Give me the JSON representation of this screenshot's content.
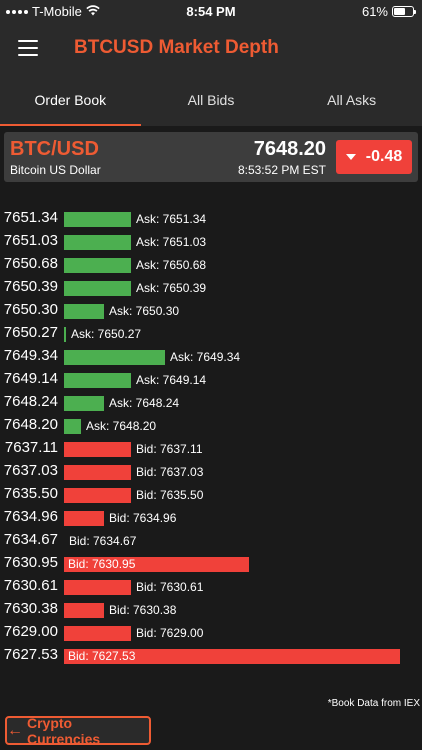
{
  "status": {
    "carrier": "T-Mobile",
    "time": "8:54 PM",
    "battery": "61%",
    "battery_level": 0.61
  },
  "header": {
    "title": "BTCUSD Market Depth"
  },
  "tabs": [
    {
      "label": "Order Book",
      "active": true
    },
    {
      "label": "All Bids",
      "active": false
    },
    {
      "label": "All Asks",
      "active": false
    }
  ],
  "ticker": {
    "symbol": "BTC/USD",
    "name": "Bitcoin US Dollar",
    "price": "7648.20",
    "time": "8:53:52 PM EST",
    "change": "-0.48"
  },
  "order_book": {
    "max_size": 1.0,
    "rows": [
      {
        "price": "7651.34",
        "side": "ask",
        "label": "Ask: 7651.34",
        "size": 0.2
      },
      {
        "price": "7651.03",
        "side": "ask",
        "label": "Ask: 7651.03",
        "size": 0.2
      },
      {
        "price": "7650.68",
        "side": "ask",
        "label": "Ask: 7650.68",
        "size": 0.2
      },
      {
        "price": "7650.39",
        "side": "ask",
        "label": "Ask: 7650.39",
        "size": 0.2
      },
      {
        "price": "7650.30",
        "side": "ask",
        "label": "Ask: 7650.30",
        "size": 0.12
      },
      {
        "price": "7650.27",
        "side": "ask",
        "label": "Ask: 7650.27",
        "size": 0.005
      },
      {
        "price": "7649.34",
        "side": "ask",
        "label": "Ask: 7649.34",
        "size": 0.3
      },
      {
        "price": "7649.14",
        "side": "ask",
        "label": "Ask: 7649.14",
        "size": 0.2
      },
      {
        "price": "7648.24",
        "side": "ask",
        "label": "Ask: 7648.24",
        "size": 0.12
      },
      {
        "price": "7648.20",
        "side": "ask",
        "label": "Ask: 7648.20",
        "size": 0.05
      },
      {
        "price": "7637.11",
        "side": "bid",
        "label": "Bid: 7637.11",
        "size": 0.2
      },
      {
        "price": "7637.03",
        "side": "bid",
        "label": "Bid: 7637.03",
        "size": 0.2
      },
      {
        "price": "7635.50",
        "side": "bid",
        "label": "Bid: 7635.50",
        "size": 0.2
      },
      {
        "price": "7634.96",
        "side": "bid",
        "label": "Bid: 7634.96",
        "size": 0.12
      },
      {
        "price": "7634.67",
        "side": "bid",
        "label": "Bid: 7634.67",
        "size": 0
      },
      {
        "price": "7630.95",
        "side": "bid",
        "label": "Bid: 7630.95",
        "size": 0.55
      },
      {
        "price": "7630.61",
        "side": "bid",
        "label": "Bid: 7630.61",
        "size": 0.2
      },
      {
        "price": "7630.38",
        "side": "bid",
        "label": "Bid: 7630.38",
        "size": 0.12
      },
      {
        "price": "7629.00",
        "side": "bid",
        "label": "Bid: 7629.00",
        "size": 0.2
      },
      {
        "price": "7627.53",
        "side": "bid",
        "label": "Bid: 7627.53",
        "size": 1.0
      }
    ]
  },
  "footnote": "*Book Data from IEX",
  "back_button": {
    "label": "Crypto Currencies",
    "icon": "arrow-left-icon"
  },
  "colors": {
    "accent": "#ee5b33",
    "ask": "#4caf50",
    "bid": "#f0413a"
  }
}
